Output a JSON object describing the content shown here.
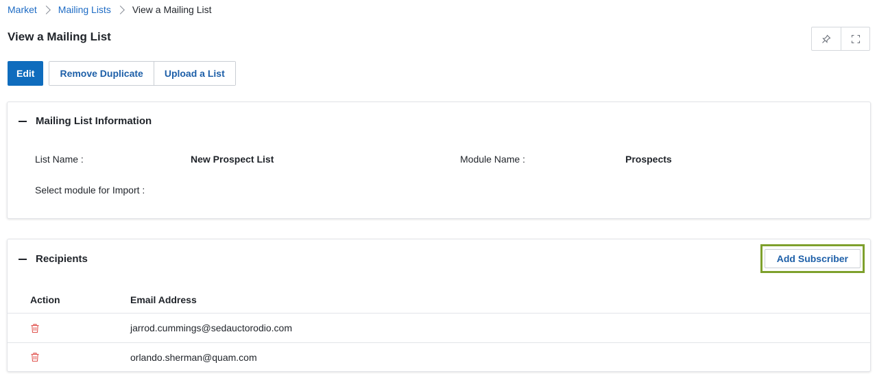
{
  "breadcrumb": {
    "items": [
      "Market",
      "Mailing Lists"
    ],
    "current": "View a Mailing List"
  },
  "page": {
    "title": "View a Mailing List"
  },
  "toolbar": {
    "edit_label": "Edit",
    "remove_duplicate_label": "Remove Duplicate",
    "upload_list_label": "Upload a List"
  },
  "header_tools": {
    "icons": [
      "pin-icon",
      "fullscreen-icon"
    ]
  },
  "info_panel": {
    "title": "Mailing List Information",
    "fields": {
      "list_name_label": "List Name :",
      "list_name_value": "New Prospect List",
      "module_name_label": "Module Name :",
      "module_name_value": "Prospects",
      "import_module_label": "Select module for Import :",
      "import_module_value": ""
    }
  },
  "recipients_panel": {
    "title": "Recipients",
    "add_button_label": "Add Subscriber",
    "columns": [
      "Action",
      "Email Address"
    ],
    "rows": [
      {
        "email": "jarrod.cummings@sedauctorodio.com"
      },
      {
        "email": "orlando.sherman@quam.com"
      }
    ]
  },
  "colors": {
    "primary": "#0f6cbd",
    "link": "#1d6bc4",
    "delete": "#e0524d",
    "highlight": "#7ea02c"
  }
}
